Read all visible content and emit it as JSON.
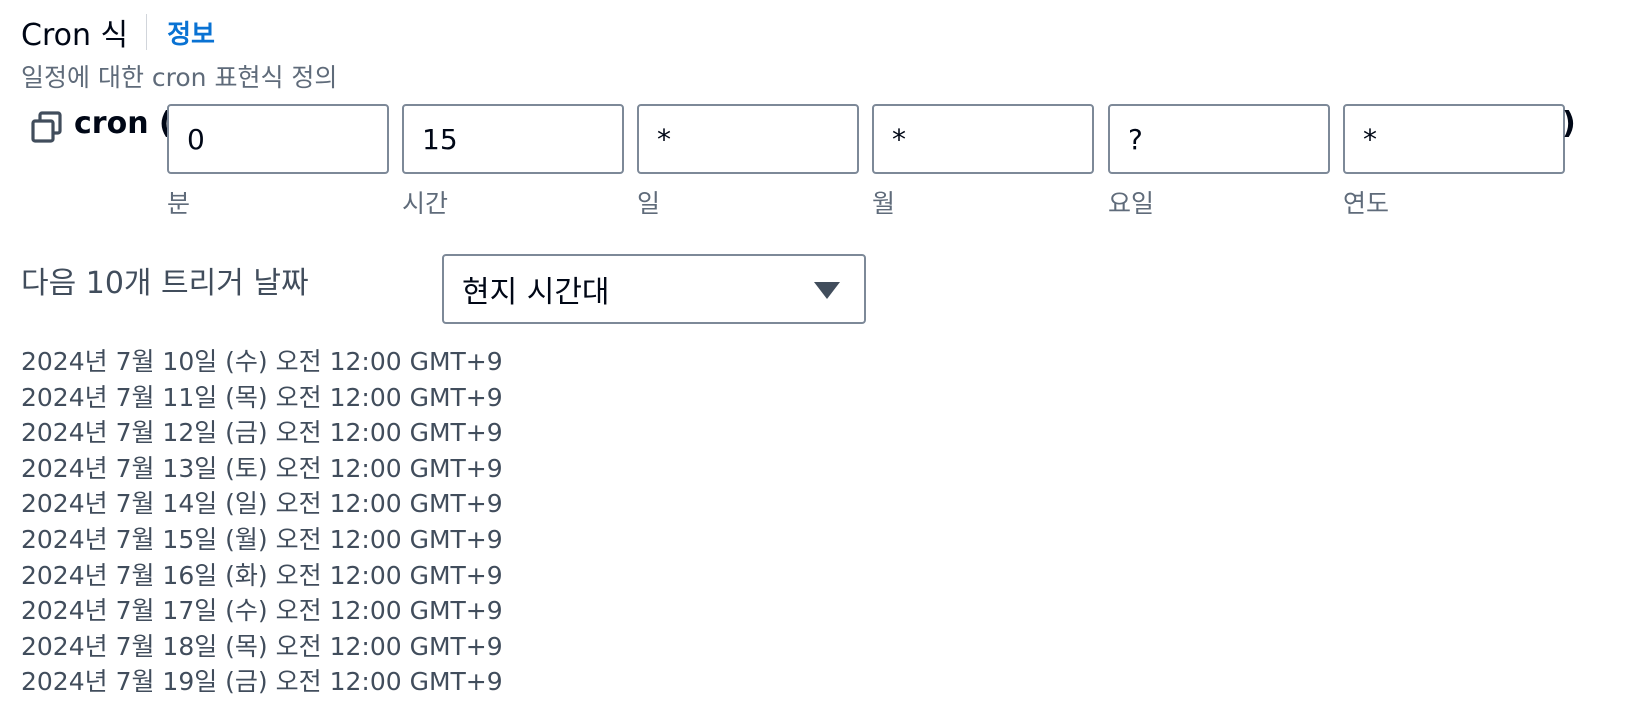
{
  "header": {
    "title": "Cron 식",
    "info_link": "정보",
    "description": "일정에 대한 cron 표현식 정의"
  },
  "cron": {
    "prefix": "cron (",
    "suffix": ")",
    "fields": [
      {
        "label": "분",
        "value": "0"
      },
      {
        "label": "시간",
        "value": "15"
      },
      {
        "label": "일",
        "value": "*"
      },
      {
        "label": "월",
        "value": "*"
      },
      {
        "label": "요일",
        "value": "?"
      },
      {
        "label": "연도",
        "value": "*"
      }
    ]
  },
  "next_triggers": {
    "label": "다음 10개 트리거 날짜",
    "timezone_selected": "현지 시간대",
    "dates": [
      "2024년 7월 10일 (수) 오전 12:00 GMT+9",
      "2024년 7월 11일 (목) 오전 12:00 GMT+9",
      "2024년 7월 12일 (금) 오전 12:00 GMT+9",
      "2024년 7월 13일 (토) 오전 12:00 GMT+9",
      "2024년 7월 14일 (일) 오전 12:00 GMT+9",
      "2024년 7월 15일 (월) 오전 12:00 GMT+9",
      "2024년 7월 16일 (화) 오전 12:00 GMT+9",
      "2024년 7월 17일 (수) 오전 12:00 GMT+9",
      "2024년 7월 18일 (목) 오전 12:00 GMT+9",
      "2024년 7월 19일 (금) 오전 12:00 GMT+9"
    ]
  },
  "icons": {
    "copy": "copy-icon",
    "dropdown": "caret-down-icon"
  },
  "colors": {
    "link": "#0972d3",
    "text": "#000716",
    "secondary_text": "#5f6b7a",
    "border": "#7d8998"
  }
}
